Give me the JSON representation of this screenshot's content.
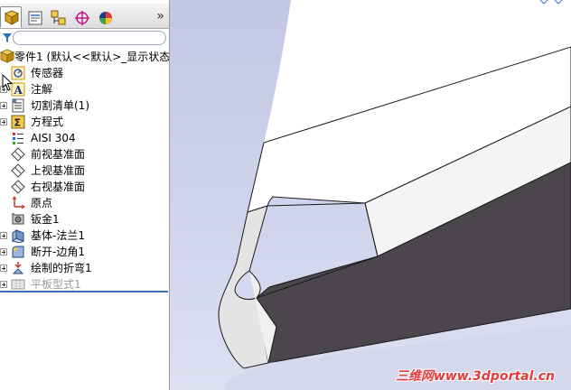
{
  "feature_tree": {
    "root": {
      "label": "零件1  (默认<<默认>_显示状态",
      "icon": "part-icon"
    },
    "items": [
      {
        "label": "传感器",
        "icon": "sensor-icon",
        "expandable": false
      },
      {
        "label": "注解",
        "icon": "annotation-icon",
        "expandable": true
      },
      {
        "label": "切割清单(1)",
        "icon": "cut-list-icon",
        "expandable": true
      },
      {
        "label": "方程式",
        "icon": "equation-icon",
        "expandable": true
      },
      {
        "label": "AISI 304",
        "icon": "material-icon",
        "expandable": false
      },
      {
        "label": "前视基准面",
        "icon": "plane-icon",
        "expandable": false
      },
      {
        "label": "上视基准面",
        "icon": "plane-icon",
        "expandable": false
      },
      {
        "label": "右视基准面",
        "icon": "plane-icon",
        "expandable": false
      },
      {
        "label": "原点",
        "icon": "origin-icon",
        "expandable": false
      },
      {
        "label": "钣金1",
        "icon": "sheet-metal-icon",
        "expandable": false
      },
      {
        "label": "基体-法兰1",
        "icon": "base-flange-icon",
        "expandable": true
      },
      {
        "label": "断开-边角1",
        "icon": "break-corner-icon",
        "expandable": true
      },
      {
        "label": "绘制的折弯1",
        "icon": "sketched-bend-icon",
        "expandable": true
      },
      {
        "label": "平板型式1",
        "icon": "flat-pattern-icon",
        "expandable": true,
        "suppressed": true
      }
    ]
  },
  "tabs": [
    {
      "name": "feature-manager",
      "icon": "feature-tree-icon",
      "active": true
    },
    {
      "name": "property-manager",
      "icon": "property-manager-icon"
    },
    {
      "name": "configuration-manager",
      "icon": "configuration-icon"
    },
    {
      "name": "dimxpert-manager",
      "icon": "dimxpert-icon"
    },
    {
      "name": "display-manager",
      "icon": "display-manager-icon"
    }
  ],
  "more_tabs_glyph": "»",
  "watermark": "三维网www.3dportal.cn",
  "colors": {
    "rollback_bar": "#3a6fb6",
    "viewport_bg": "#c8ccea",
    "part_face_dark": "#4a464c",
    "watermark": "#e63b3b"
  }
}
